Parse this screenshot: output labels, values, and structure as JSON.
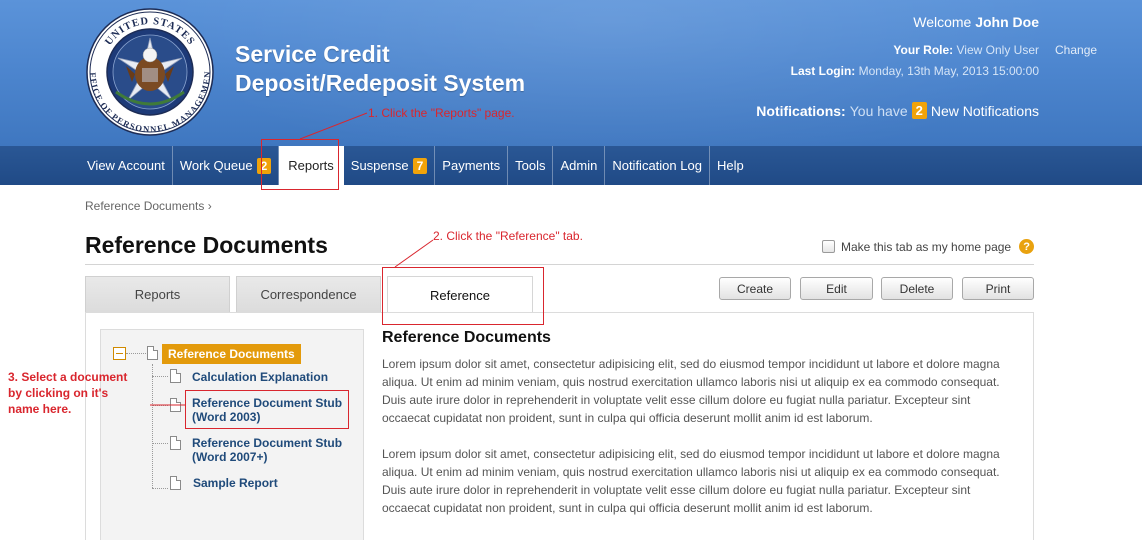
{
  "header": {
    "seal": {
      "top_text": "UNITED STATES",
      "bottom_text": "OFFICE OF PERSONNEL MANAGEMENT"
    },
    "title_line1": "Service Credit",
    "title_line2": "Deposit/Redeposit System",
    "welcome_prefix": "Welcome",
    "user_name": "John Doe",
    "role_label": "Your Role:",
    "role_value": "View Only User",
    "change_label": "Change",
    "last_login_label": "Last Login:",
    "last_login_value": "Monday, 13th May, 2013 15:00:00",
    "notifications_label": "Notifications:",
    "notifications_pre": "You have",
    "notifications_count": "2",
    "notifications_post": "New Notifications"
  },
  "nav": {
    "items": [
      {
        "label": "View Account"
      },
      {
        "label": "Work Queue",
        "badge": "2"
      },
      {
        "label": "Reports",
        "active": true
      },
      {
        "label": "Suspense",
        "badge": "7"
      },
      {
        "label": "Payments"
      },
      {
        "label": "Tools"
      },
      {
        "label": "Admin"
      },
      {
        "label": "Notification Log"
      },
      {
        "label": "Help"
      }
    ]
  },
  "breadcrumb": "Reference Documents ›",
  "page_title": "Reference Documents",
  "home_pref_label": "Make this tab as my home page",
  "tabs": [
    {
      "label": "Reports"
    },
    {
      "label": "Correspondence"
    },
    {
      "label": "Reference",
      "active": true
    }
  ],
  "toolbar": {
    "create": "Create",
    "edit": "Edit",
    "delete": "Delete",
    "print": "Print"
  },
  "tree": {
    "root": "Reference Documents",
    "items": [
      {
        "line1": "Calculation Explanation",
        "line2": ""
      },
      {
        "line1": "Reference Document Stub",
        "line2": "(Word 2003)"
      },
      {
        "line1": "Reference Document Stub",
        "line2": "(Word 2007+)"
      },
      {
        "line1": "Sample Report",
        "line2": ""
      }
    ]
  },
  "content": {
    "title": "Reference Documents",
    "paragraph1": "Lorem ipsum dolor sit amet, consectetur adipisicing elit, sed do eiusmod tempor incididunt ut labore et dolore magna aliqua. Ut enim ad minim veniam, quis nostrud exercitation ullamco laboris nisi ut aliquip ex ea commodo consequat. Duis aute irure dolor in reprehenderit in voluptate velit esse cillum dolore eu fugiat nulla pariatur. Excepteur sint occaecat cupidatat non proident, sunt in culpa qui officia deserunt mollit anim id est laborum.",
    "paragraph2": "Lorem ipsum dolor sit amet, consectetur adipisicing elit, sed do eiusmod tempor incididunt ut labore et dolore magna aliqua. Ut enim ad minim veniam, quis nostrud exercitation ullamco laboris nisi ut aliquip ex ea commodo consequat. Duis aute irure dolor in reprehenderit in voluptate velit esse cillum dolore eu fugiat nulla pariatur. Excepteur sint occaecat cupidatat non proident, sunt in culpa qui officia deserunt mollit anim id est laborum."
  },
  "annotations": {
    "step1": "1. Click the \"Reports\" page.",
    "step2": "2. Click the \"Reference\" tab.",
    "step3_line1": "3. Select a document",
    "step3_line2": "by clicking on it's",
    "step3_line3": "name here."
  },
  "colors": {
    "header_blue": "#4d86cf",
    "nav_blue": "#224c89",
    "badge_orange": "#f0a30a",
    "annotation_red": "#d9262e",
    "tree_link": "#1f4a7a"
  }
}
